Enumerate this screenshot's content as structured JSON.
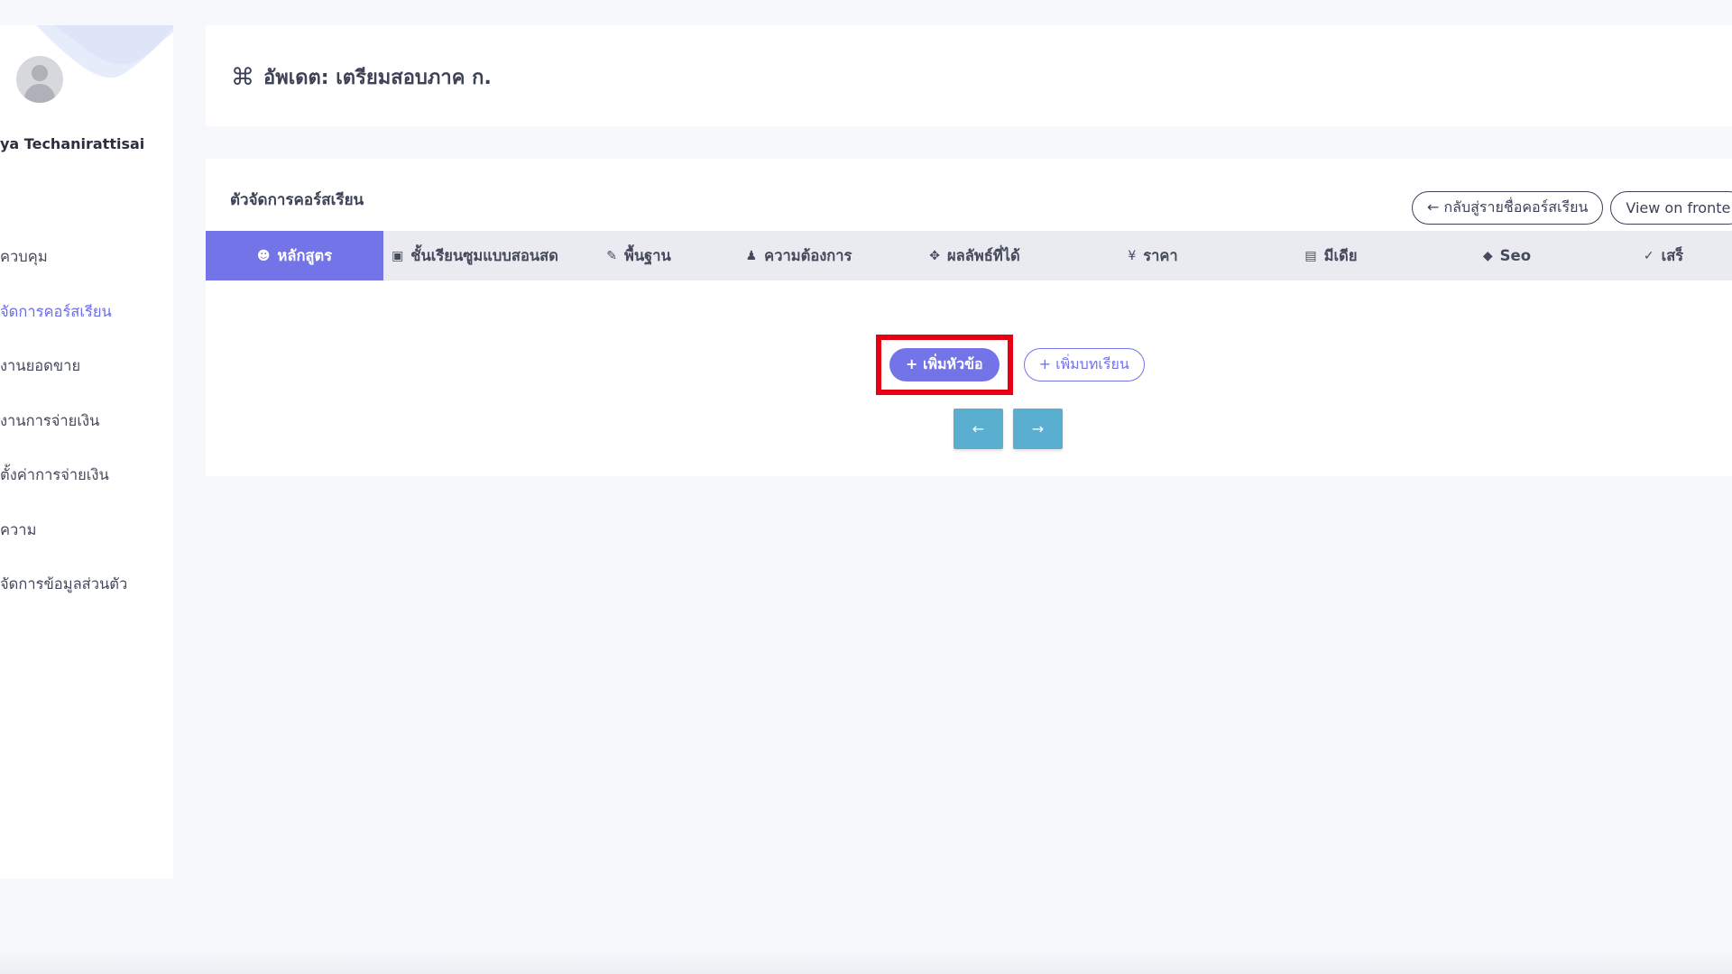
{
  "sidebar": {
    "user_name": "ya Techanirattisai",
    "items": [
      {
        "label": "ควบคุม",
        "active": false
      },
      {
        "label": "จัดการคอร์สเรียน",
        "active": true
      },
      {
        "label": "งานยอดขาย",
        "active": false
      },
      {
        "label": "งานการจ่ายเงิน",
        "active": false
      },
      {
        "label": "ตั้งค่าการจ่ายเงิน",
        "active": false
      },
      {
        "label": "ความ",
        "active": false
      },
      {
        "label": "จัดการข้อมูลส่วนตัว",
        "active": false
      }
    ]
  },
  "header": {
    "icon": "command-icon",
    "title": "อัพเดต: เตรียมสอบภาค ก."
  },
  "course_manager": {
    "section_title": "ตัวจัดการคอร์สเรียน",
    "back_button": "← กลับสู่รายชื่อคอร์สเรียน",
    "view_frontend_button": "View on fronte",
    "tabs": [
      {
        "icon": "☻",
        "label": "หลักสูตร",
        "active": true
      },
      {
        "icon": "▣",
        "label": "ชั้นเรียนซูมแบบสอนสด",
        "active": false
      },
      {
        "icon": "✎",
        "label": "พื้นฐาน",
        "active": false
      },
      {
        "icon": "♟",
        "label": "ความต้องการ",
        "active": false
      },
      {
        "icon": "✥",
        "label": "ผลลัพธ์ที่ได้",
        "active": false
      },
      {
        "icon": "¥",
        "label": "ราคา",
        "active": false
      },
      {
        "icon": "▤",
        "label": "มีเดีย",
        "active": false
      },
      {
        "icon": "◆",
        "label": "Seo",
        "active": false
      },
      {
        "icon": "✓",
        "label": "เสร็",
        "active": false
      }
    ],
    "add_section_button": "+ เพิ่มหัวข้อ",
    "add_lesson_button": "+ เพิ่มบทเรียน",
    "prev_button": "←",
    "next_button": "→"
  },
  "colors": {
    "accent": "#7374e8",
    "highlight": "#e50012",
    "nav_button": "#5aaed0",
    "tabbar": "#e9ebf1"
  }
}
